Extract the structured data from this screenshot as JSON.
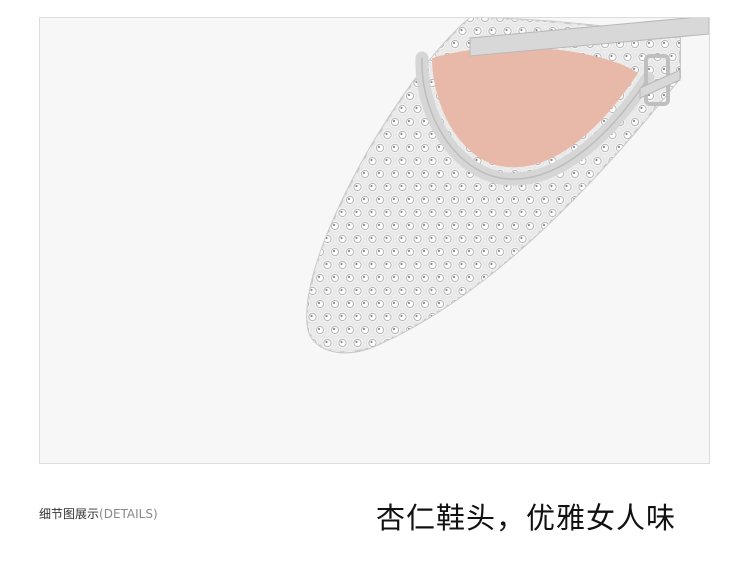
{
  "photo": {
    "subject": "shoe-toe-closeup",
    "colors": {
      "background": "#f7f7f7",
      "mesh": "#e6e6e6",
      "rhinestone": "#ffffff",
      "silver_trim": "#d9d9d9",
      "insole": "#e8b8a8",
      "buckle": "#cfcfcf"
    }
  },
  "caption": {
    "section_label": "细节图展示",
    "section_label_sub": "(DETAILS)",
    "headline": "杏仁鞋头，优雅女人味"
  }
}
